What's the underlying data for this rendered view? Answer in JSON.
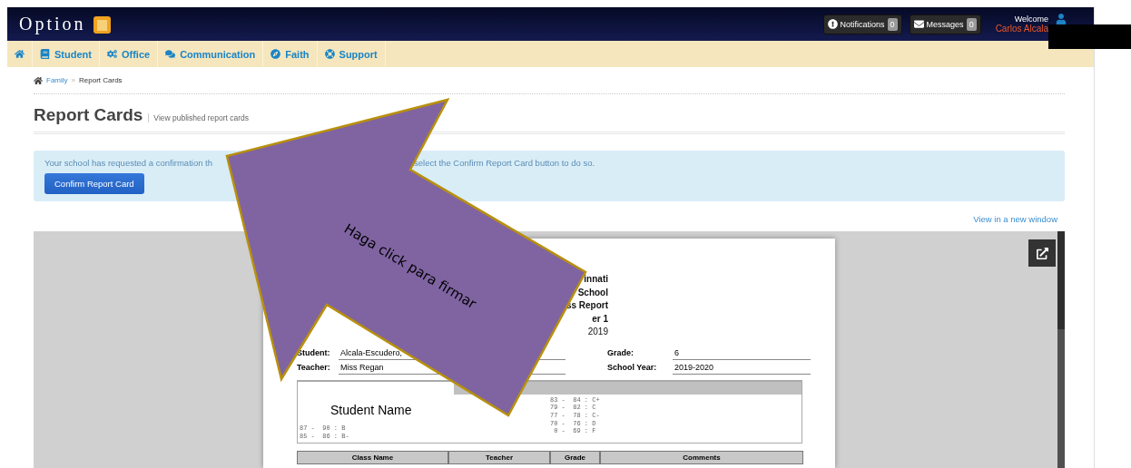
{
  "header": {
    "logo": "Option",
    "notifications": {
      "label": "Notifications",
      "count": "0"
    },
    "messages": {
      "label": "Messages",
      "count": "0"
    },
    "welcome": "Welcome",
    "user": "Carlos Alcala"
  },
  "nav": [
    {
      "kind": "home"
    },
    {
      "kind": "student",
      "label": "Student"
    },
    {
      "kind": "office",
      "label": "Office"
    },
    {
      "kind": "communication",
      "label": "Communication"
    },
    {
      "kind": "faith",
      "label": "Faith"
    },
    {
      "kind": "support",
      "label": "Support"
    }
  ],
  "breadcrumb": {
    "link": "Family",
    "separator": "»",
    "current": "Report Cards"
  },
  "page": {
    "title": "Report Cards",
    "subtitle": "View published report cards"
  },
  "alert": {
    "text_before": "Your school has requested a confirmation th",
    "text_after": "select the Confirm Report Card button to do so.",
    "button": "Confirm Report Card"
  },
  "view_link": "View in a new window",
  "document": {
    "heading_lines": [
      "innati",
      "School",
      "ss Report",
      "er 1",
      "2019"
    ],
    "fields": [
      {
        "label": "Student:",
        "value": "Alcala-Escudero,"
      },
      {
        "label": "Grade:",
        "value": "6"
      },
      {
        "label": "Teacher:",
        "value": "Miss Regan"
      },
      {
        "label": "School Year:",
        "value": "2019-2020"
      }
    ],
    "scale_left": [
      "87 -  90 : B",
      "85 -  86 : B-"
    ],
    "scale_right": [
      "83 -  84 : C+",
      "79 -  82 : C",
      "77 -  78 : C-",
      "70 -  76 : D",
      " 0 -  69 : F"
    ],
    "columns": [
      "Class Name",
      "Teacher",
      "Grade",
      "Comments"
    ]
  },
  "annotation": {
    "arrow_text": "Haga click para firmar",
    "note": "Student Name"
  }
}
